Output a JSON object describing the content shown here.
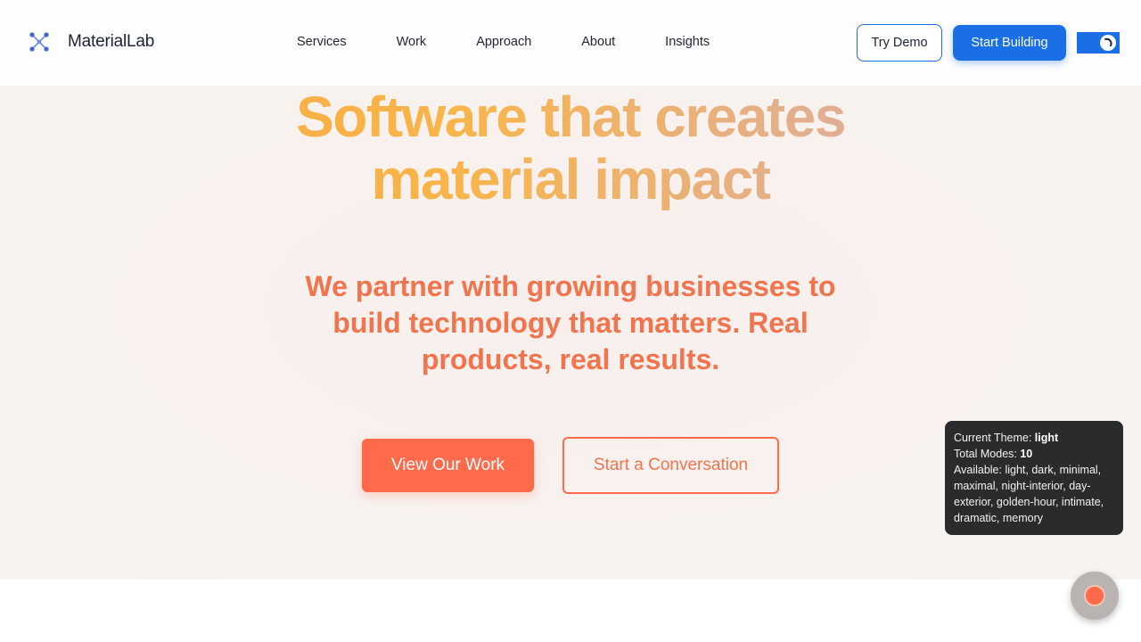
{
  "brand": {
    "name": "MaterialLab",
    "logo_icon": "network-nodes-icon",
    "accent": "#1a6ee6"
  },
  "nav": {
    "items": [
      "Services",
      "Work",
      "Approach",
      "About",
      "Insights"
    ]
  },
  "header": {
    "try_demo_label": "Try Demo",
    "start_building_label": "Start Building",
    "theme_toggle_icon": "crescent-moon-icon"
  },
  "hero": {
    "title_line1": "Software that creates",
    "title_line2": "material impact",
    "subtitle": "We partner with growing businesses to build technology that matters. Real products, real results.",
    "primary_cta": "View Our Work",
    "secondary_cta": "Start a Conversation",
    "colors": {
      "primary": "#ff6a4b",
      "title_gradient_start": "#f9a53c",
      "title_gradient_end": "#d9a58f"
    }
  },
  "theme_panel": {
    "current_label": "Current Theme:",
    "current_value": "light",
    "total_label": "Total Modes:",
    "total_value": "10",
    "available_label": "Available:",
    "available_value": "light, dark, minimal, maximal, night-interior, day-exterior, golden-hour, intimate, dramatic, memory"
  },
  "fab": {
    "icon": "record-dot-icon"
  }
}
